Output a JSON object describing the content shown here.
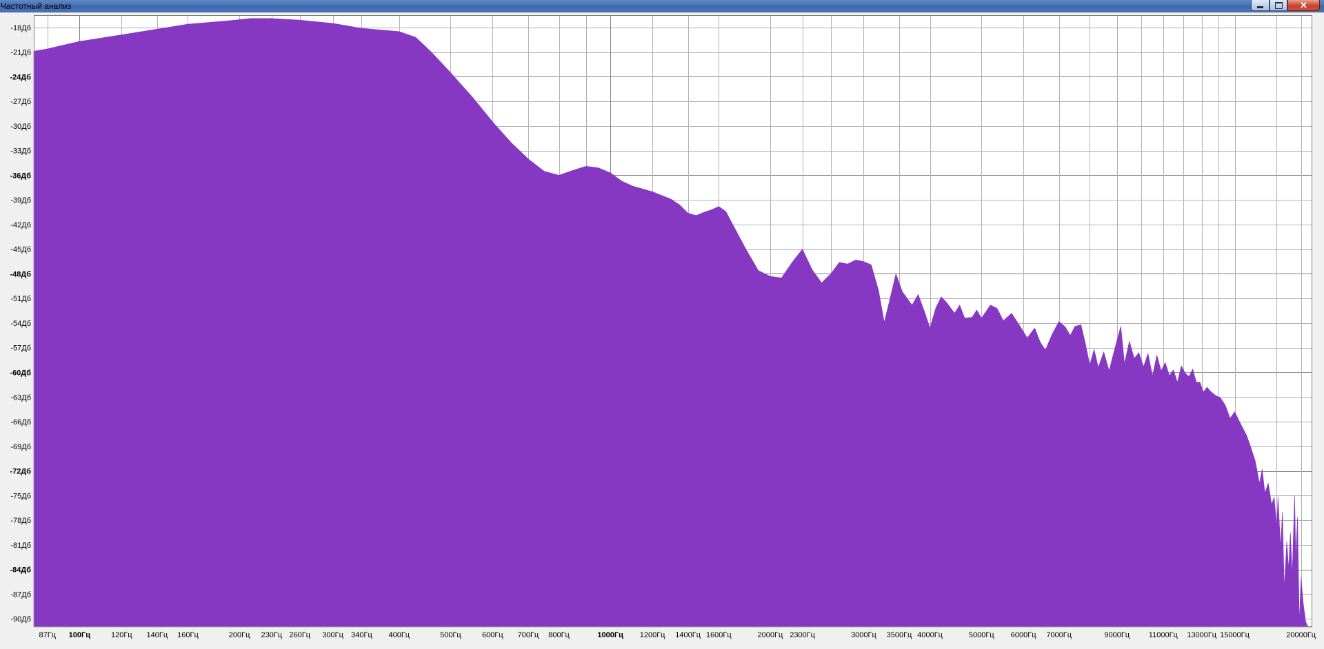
{
  "window": {
    "title": "Частотный анализ",
    "controls": {
      "minimize_icon": "minimize-icon",
      "maximize_icon": "maximize-icon",
      "close_icon": "close-icon"
    }
  },
  "colors": {
    "fill": "#8638c2",
    "plot_background": "#ffffff",
    "grid": "#b0b0b0",
    "grid_major": "#808080",
    "window_background": "#f0f0f0"
  },
  "chart_data": {
    "type": "area",
    "title": "",
    "xlabel": "",
    "ylabel": "",
    "x_scale": "log",
    "grid": true,
    "xlim": [
      82,
      21000
    ],
    "ylim": [
      -91,
      -16.5
    ],
    "y_ticks": [
      {
        "value": -18,
        "label": "-18Дб",
        "major": false
      },
      {
        "value": -21,
        "label": "-21Дб",
        "major": false
      },
      {
        "value": -24,
        "label": "-24Дб",
        "major": true
      },
      {
        "value": -27,
        "label": "-27Дб",
        "major": false
      },
      {
        "value": -30,
        "label": "-30Дб",
        "major": false
      },
      {
        "value": -33,
        "label": "-33Дб",
        "major": false
      },
      {
        "value": -36,
        "label": "-36Дб",
        "major": true
      },
      {
        "value": -39,
        "label": "-39Дб",
        "major": false
      },
      {
        "value": -42,
        "label": "-42Дб",
        "major": false
      },
      {
        "value": -45,
        "label": "-45Дб",
        "major": false
      },
      {
        "value": -48,
        "label": "-48Дб",
        "major": true
      },
      {
        "value": -51,
        "label": "-51Дб",
        "major": false
      },
      {
        "value": -54,
        "label": "-54Дб",
        "major": false
      },
      {
        "value": -57,
        "label": "-57Дб",
        "major": false
      },
      {
        "value": -60,
        "label": "-60Дб",
        "major": true
      },
      {
        "value": -63,
        "label": "-63Дб",
        "major": false
      },
      {
        "value": -66,
        "label": "-66Дб",
        "major": false
      },
      {
        "value": -69,
        "label": "-69Дб",
        "major": false
      },
      {
        "value": -72,
        "label": "-72Дб",
        "major": true
      },
      {
        "value": -75,
        "label": "-75Дб",
        "major": false
      },
      {
        "value": -78,
        "label": "-78Дб",
        "major": false
      },
      {
        "value": -81,
        "label": "-81Дб",
        "major": false
      },
      {
        "value": -84,
        "label": "-84Дб",
        "major": true
      },
      {
        "value": -87,
        "label": "-87Дб",
        "major": false
      },
      {
        "value": -90,
        "label": "-90Дб",
        "major": false
      }
    ],
    "x_ticks": [
      {
        "value": 87,
        "label": "87Гц",
        "major": false
      },
      {
        "value": 100,
        "label": "100Гц",
        "major": true
      },
      {
        "value": 120,
        "label": "120Гц",
        "major": false
      },
      {
        "value": 140,
        "label": "140Гц",
        "major": false
      },
      {
        "value": 160,
        "label": "160Гц",
        "major": false
      },
      {
        "value": 200,
        "label": "200Гц",
        "major": false
      },
      {
        "value": 230,
        "label": "230Гц",
        "major": false
      },
      {
        "value": 260,
        "label": "260Гц",
        "major": false
      },
      {
        "value": 300,
        "label": "300Гц",
        "major": false
      },
      {
        "value": 340,
        "label": "340Гц",
        "major": false
      },
      {
        "value": 400,
        "label": "400Гц",
        "major": false
      },
      {
        "value": 500,
        "label": "500Гц",
        "major": false
      },
      {
        "value": 600,
        "label": "600Гц",
        "major": false
      },
      {
        "value": 700,
        "label": "700Гц",
        "major": false
      },
      {
        "value": 800,
        "label": "800Гц",
        "major": false
      },
      {
        "value": 1000,
        "label": "1000Гц",
        "major": true
      },
      {
        "value": 1200,
        "label": "1200Гц",
        "major": false
      },
      {
        "value": 1400,
        "label": "1400Гц",
        "major": false
      },
      {
        "value": 1600,
        "label": "1600Гц",
        "major": false
      },
      {
        "value": 2000,
        "label": "2000Гц",
        "major": false
      },
      {
        "value": 2300,
        "label": "2300Гц",
        "major": false
      },
      {
        "value": 3000,
        "label": "3000Гц",
        "major": false
      },
      {
        "value": 3500,
        "label": "3500Гц",
        "major": false
      },
      {
        "value": 4000,
        "label": "4000Гц",
        "major": false
      },
      {
        "value": 5000,
        "label": "5000Гц",
        "major": false
      },
      {
        "value": 6000,
        "label": "6000Гц",
        "major": false
      },
      {
        "value": 7000,
        "label": "7000Гц",
        "major": false
      },
      {
        "value": 9000,
        "label": "9000Гц",
        "major": false
      },
      {
        "value": 11000,
        "label": "11000Гц",
        "major": false
      },
      {
        "value": 13000,
        "label": "13000Гц",
        "major": false
      },
      {
        "value": 15000,
        "label": "15000Гц",
        "major": false
      },
      {
        "value": 20000,
        "label": "20000Гц",
        "major": false
      }
    ],
    "x_unlabeled_gridlines": [
      900,
      2600,
      8000,
      10000,
      12000,
      14000,
      18000
    ],
    "series": [
      {
        "color": "#8638c2",
        "points": [
          [
            82,
            -20.9
          ],
          [
            87,
            -20.6
          ],
          [
            100,
            -19.7
          ],
          [
            120,
            -18.9
          ],
          [
            140,
            -18.2
          ],
          [
            160,
            -17.6
          ],
          [
            190,
            -17.2
          ],
          [
            210,
            -16.9
          ],
          [
            230,
            -16.9
          ],
          [
            260,
            -17.1
          ],
          [
            300,
            -17.5
          ],
          [
            340,
            -18.1
          ],
          [
            370,
            -18.3
          ],
          [
            400,
            -18.5
          ],
          [
            430,
            -19.2
          ],
          [
            460,
            -21.0
          ],
          [
            500,
            -23.5
          ],
          [
            550,
            -26.5
          ],
          [
            600,
            -29.5
          ],
          [
            650,
            -32.0
          ],
          [
            700,
            -34.0
          ],
          [
            750,
            -35.5
          ],
          [
            800,
            -36.0
          ],
          [
            850,
            -35.4
          ],
          [
            900,
            -34.9
          ],
          [
            950,
            -35.1
          ],
          [
            1000,
            -35.7
          ],
          [
            1050,
            -36.7
          ],
          [
            1100,
            -37.3
          ],
          [
            1200,
            -38.0
          ],
          [
            1300,
            -38.9
          ],
          [
            1350,
            -39.6
          ],
          [
            1400,
            -40.6
          ],
          [
            1450,
            -40.9
          ],
          [
            1500,
            -40.5
          ],
          [
            1550,
            -40.2
          ],
          [
            1600,
            -39.8
          ],
          [
            1650,
            -40.4
          ],
          [
            1700,
            -42.0
          ],
          [
            1800,
            -45.0
          ],
          [
            1900,
            -47.6
          ],
          [
            2000,
            -48.3
          ],
          [
            2100,
            -48.5
          ],
          [
            2200,
            -46.6
          ],
          [
            2300,
            -45.0
          ],
          [
            2400,
            -47.5
          ],
          [
            2500,
            -49.1
          ],
          [
            2600,
            -48.0
          ],
          [
            2700,
            -46.6
          ],
          [
            2800,
            -46.8
          ],
          [
            2900,
            -46.3
          ],
          [
            3000,
            -46.5
          ],
          [
            3100,
            -46.9
          ],
          [
            3200,
            -50.0
          ],
          [
            3280,
            -53.9
          ],
          [
            3350,
            -51.5
          ],
          [
            3450,
            -48.0
          ],
          [
            3550,
            -50.2
          ],
          [
            3700,
            -51.8
          ],
          [
            3800,
            -50.5
          ],
          [
            3900,
            -52.5
          ],
          [
            4000,
            -54.6
          ],
          [
            4100,
            -52.2
          ],
          [
            4200,
            -50.8
          ],
          [
            4300,
            -51.5
          ],
          [
            4450,
            -52.8
          ],
          [
            4550,
            -51.8
          ],
          [
            4650,
            -53.4
          ],
          [
            4800,
            -53.3
          ],
          [
            4900,
            -52.4
          ],
          [
            5000,
            -53.4
          ],
          [
            5200,
            -51.8
          ],
          [
            5350,
            -52.2
          ],
          [
            5500,
            -53.7
          ],
          [
            5700,
            -52.8
          ],
          [
            5900,
            -54.3
          ],
          [
            6100,
            -55.8
          ],
          [
            6300,
            -54.6
          ],
          [
            6450,
            -56.3
          ],
          [
            6600,
            -57.3
          ],
          [
            6800,
            -55.3
          ],
          [
            7000,
            -53.8
          ],
          [
            7200,
            -54.5
          ],
          [
            7350,
            -55.5
          ],
          [
            7500,
            -54.4
          ],
          [
            7700,
            -54.2
          ],
          [
            7850,
            -56.5
          ],
          [
            8000,
            -59.1
          ],
          [
            8150,
            -57.2
          ],
          [
            8300,
            -59.4
          ],
          [
            8500,
            -57.5
          ],
          [
            8700,
            -59.8
          ],
          [
            8900,
            -57.3
          ],
          [
            9150,
            -54.4
          ],
          [
            9300,
            -58.9
          ],
          [
            9500,
            -56.2
          ],
          [
            9700,
            -58.3
          ],
          [
            9900,
            -57.6
          ],
          [
            10100,
            -59.3
          ],
          [
            10300,
            -57.7
          ],
          [
            10500,
            -60.4
          ],
          [
            10700,
            -57.9
          ],
          [
            10900,
            -59.8
          ],
          [
            11100,
            -58.8
          ],
          [
            11300,
            -60.4
          ],
          [
            11500,
            -59.7
          ],
          [
            11700,
            -61.2
          ],
          [
            11900,
            -59.2
          ],
          [
            12100,
            -60.1
          ],
          [
            12300,
            -60.5
          ],
          [
            12500,
            -59.6
          ],
          [
            12700,
            -61.2
          ],
          [
            12900,
            -61.2
          ],
          [
            13100,
            -62.4
          ],
          [
            13300,
            -61.8
          ],
          [
            13500,
            -62.3
          ],
          [
            13800,
            -62.8
          ],
          [
            14100,
            -63.1
          ],
          [
            14400,
            -64.0
          ],
          [
            14700,
            -65.6
          ],
          [
            15000,
            -64.8
          ],
          [
            15400,
            -66.3
          ],
          [
            15800,
            -67.7
          ],
          [
            16100,
            -69.2
          ],
          [
            16400,
            -70.8
          ],
          [
            16700,
            -73.5
          ],
          [
            16900,
            -71.8
          ],
          [
            17100,
            -74.7
          ],
          [
            17350,
            -73.5
          ],
          [
            17600,
            -76.1
          ],
          [
            17800,
            -75.2
          ],
          [
            18000,
            -78.7
          ],
          [
            18100,
            -75.1
          ],
          [
            18300,
            -81.3
          ],
          [
            18450,
            -77.0
          ],
          [
            18600,
            -86.3
          ],
          [
            18800,
            -80.6
          ],
          [
            18950,
            -83.9
          ],
          [
            19100,
            -79.5
          ],
          [
            19250,
            -84.7
          ],
          [
            19450,
            -75.0
          ],
          [
            19550,
            -82.6
          ],
          [
            19700,
            -77.6
          ],
          [
            19850,
            -90.5
          ],
          [
            20000,
            -85.0
          ],
          [
            20200,
            -88.2
          ],
          [
            20400,
            -90.3
          ],
          [
            20600,
            -91.0
          ],
          [
            20800,
            -91.0
          ],
          [
            21000,
            -91.0
          ]
        ]
      }
    ]
  }
}
